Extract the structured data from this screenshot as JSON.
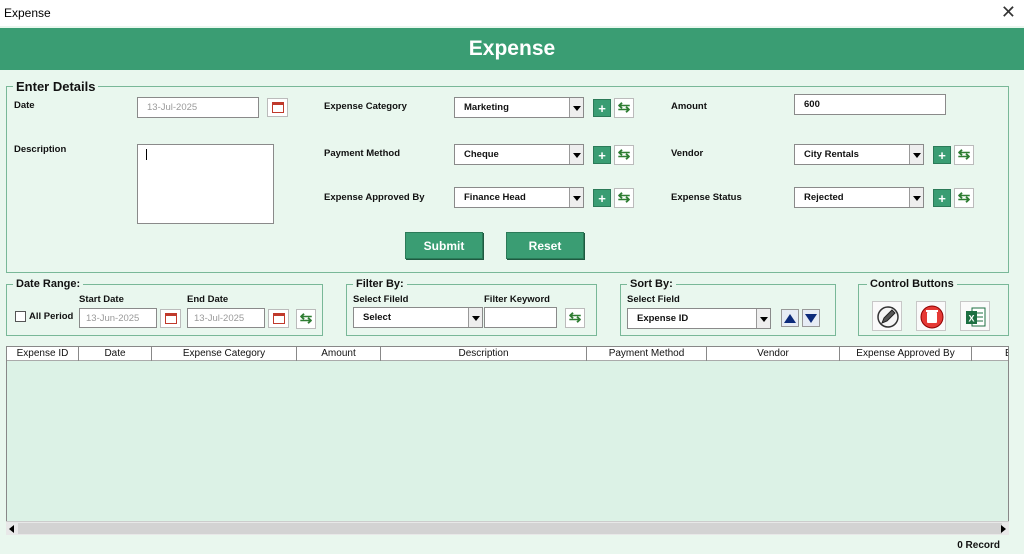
{
  "window": {
    "title": "Expense",
    "close_glyph": "✕"
  },
  "banner": {
    "title": "Expense"
  },
  "details": {
    "legend": "Enter Details",
    "date_label": "Date",
    "date_value": "13-Jul-2025",
    "description_label": "Description",
    "description_value": "",
    "category_label": "Expense Category",
    "category_value": "Marketing",
    "payment_label": "Payment Method",
    "payment_value": "Cheque",
    "approved_label": "Expense Approved By",
    "approved_value": "Finance Head",
    "amount_label": "Amount",
    "amount_value": "600",
    "vendor_label": "Vendor",
    "vendor_value": "City Rentals",
    "status_label": "Expense Status",
    "status_value": "Rejected",
    "plus_glyph": "+",
    "refresh_glyph": "⇆",
    "submit": "Submit",
    "reset": "Reset"
  },
  "date_range": {
    "legend": "Date Range:",
    "all_period": "All Period",
    "start_label": "Start Date",
    "start_value": "13-Jun-2025",
    "end_label": "End Date",
    "end_value": "13-Jul-2025"
  },
  "filter": {
    "legend": "Filter By:",
    "field_label": "Select Fileld",
    "field_value": "Select",
    "keyword_label": "Filter Keyword",
    "keyword_value": ""
  },
  "sort": {
    "legend": "Sort By:",
    "field_label": "Select Field",
    "field_value": "Expense ID"
  },
  "controls": {
    "legend": "Control Buttons"
  },
  "list": {
    "columns": [
      "Expense ID",
      "Date",
      "Expense Category",
      "Amount",
      "Description",
      "Payment Method",
      "Vendor",
      "Expense Approved By",
      "E"
    ]
  },
  "footer": {
    "records": "0 Record"
  },
  "colors": {
    "accent": "#3a9d73",
    "panel": "#e9f7ee",
    "list_bg": "#dcf2e6"
  },
  "icons": [
    "calendar-icon",
    "refresh-icon",
    "plus-icon",
    "edit-icon",
    "delete-icon",
    "excel-icon",
    "sort-up-icon",
    "sort-down-icon",
    "close-icon"
  ]
}
